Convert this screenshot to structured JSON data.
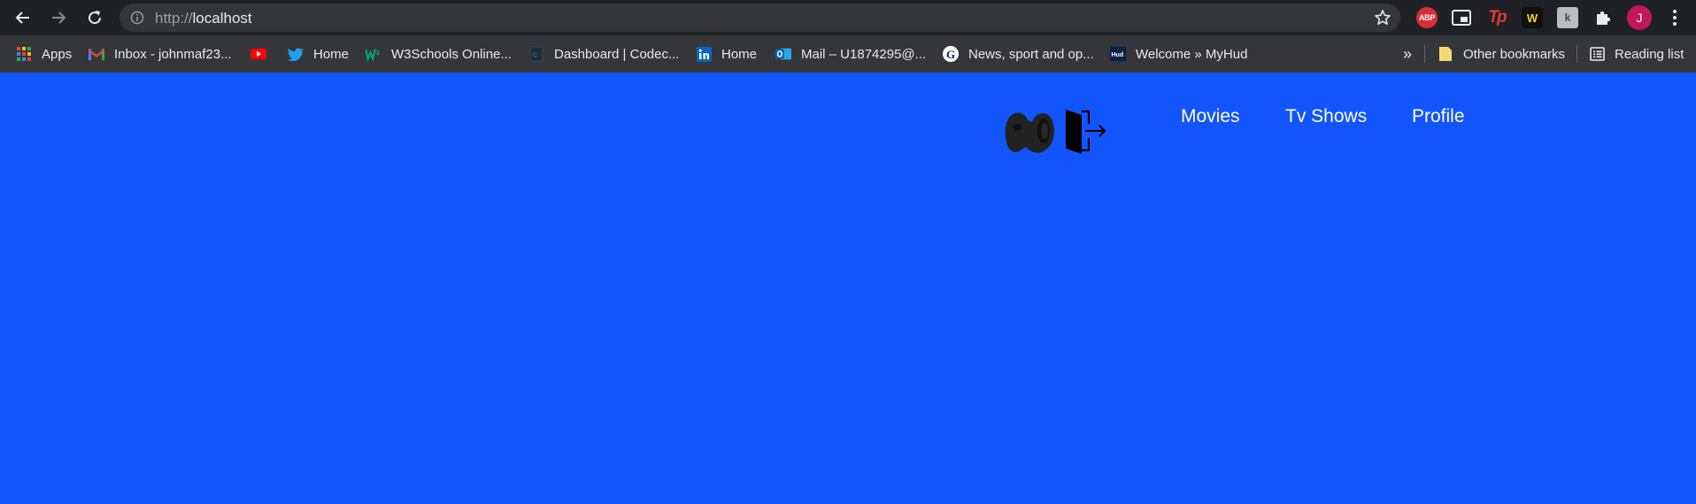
{
  "browser": {
    "address_bar": {
      "scheme": "http://",
      "host": "localhost"
    },
    "extensions": [
      {
        "name": "adblock-plus-icon",
        "label": "ABP"
      },
      {
        "name": "picture-in-picture-icon"
      },
      {
        "name": "tp-extension-icon",
        "label": "Tp"
      },
      {
        "name": "w-extension-icon",
        "label": "W"
      },
      {
        "name": "k-extension-icon",
        "label": "k"
      },
      {
        "name": "puzzle-piece-icon"
      }
    ],
    "profile_initial": "J",
    "profile_color": "#c2185b"
  },
  "bookmarks": {
    "items": [
      {
        "label": "Apps",
        "icon": "apps-grid-icon"
      },
      {
        "label": "Inbox - johnmaf23...",
        "icon": "gmail-icon"
      },
      {
        "label": "",
        "icon": "youtube-icon"
      },
      {
        "label": "Home",
        "icon": "twitter-icon"
      },
      {
        "label": "W3Schools Online...",
        "icon": "w3schools-icon"
      },
      {
        "label": "Dashboard | Codec...",
        "icon": "codecademy-icon"
      },
      {
        "label": "Home",
        "icon": "linkedin-icon"
      },
      {
        "label": "Mail – U1874295@...",
        "icon": "outlook-icon"
      },
      {
        "label": "News, sport and op...",
        "icon": "guardian-icon"
      },
      {
        "label": "Welcome » MyHud",
        "icon": "myhud-icon"
      }
    ],
    "overflow": "»",
    "other_bookmarks": "Other bookmarks",
    "reading_list": "Reading list"
  },
  "page": {
    "background": "#1255fd",
    "nav": {
      "movies": "Movies",
      "tv_shows": "Tv Shows",
      "profile": "Profile"
    }
  }
}
